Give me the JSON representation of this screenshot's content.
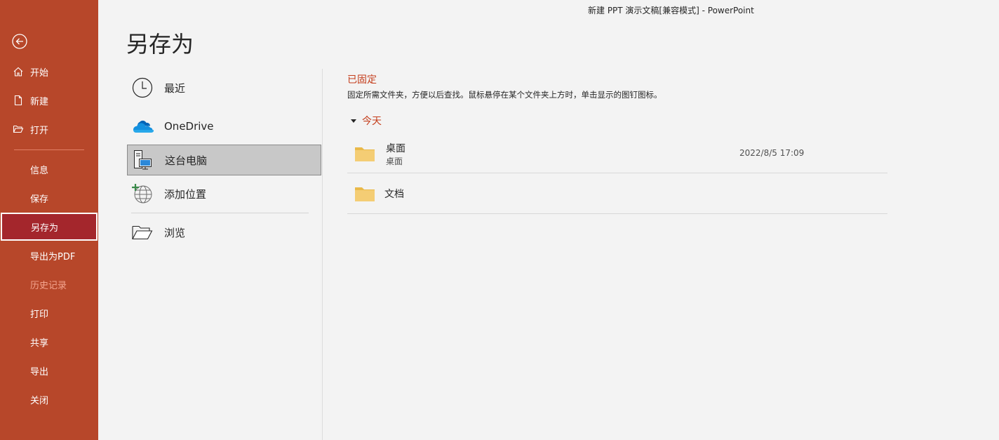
{
  "window": {
    "title": "新建 PPT 演示文稿[兼容模式]  -  PowerPoint"
  },
  "page": {
    "title": "另存为"
  },
  "sidebar": {
    "items": [
      {
        "label": "开始",
        "icon": "home-icon"
      },
      {
        "label": "新建",
        "icon": "new-file-icon"
      },
      {
        "label": "打开",
        "icon": "open-folder-icon"
      },
      {
        "label": "信息"
      },
      {
        "label": "保存"
      },
      {
        "label": "另存为",
        "state": "active"
      },
      {
        "label": "导出为PDF"
      },
      {
        "label": "历史记录",
        "state": "disabled"
      },
      {
        "label": "打印"
      },
      {
        "label": "共享"
      },
      {
        "label": "导出"
      },
      {
        "label": "关闭"
      }
    ]
  },
  "locations": {
    "items": [
      {
        "label": "最近",
        "icon": "clock-icon"
      },
      {
        "label": "OneDrive",
        "icon": "onedrive-cloud-icon"
      },
      {
        "label": "这台电脑",
        "icon": "this-pc-icon",
        "selected": true
      },
      {
        "label": "添加位置",
        "icon": "add-location-globe-icon"
      },
      {
        "label": "浏览",
        "icon": "browse-folder-icon"
      }
    ]
  },
  "pinned": {
    "heading": "已固定",
    "description": "固定所需文件夹，方便以后查找。鼠标悬停在某个文件夹上方时，单击显示的图钉图标。"
  },
  "today": {
    "heading": "今天",
    "folders": [
      {
        "name": "桌面",
        "path": "桌面",
        "modified": "2022/8/5 17:09"
      },
      {
        "name": "文档"
      }
    ]
  },
  "colors": {
    "sidebar_bg": "#b7472a",
    "active_item_bg": "#a4262c",
    "accent_text": "#c43e1c",
    "folder_yellow": "#f0c86e",
    "onedrive_blue": "#0f6cbd"
  }
}
